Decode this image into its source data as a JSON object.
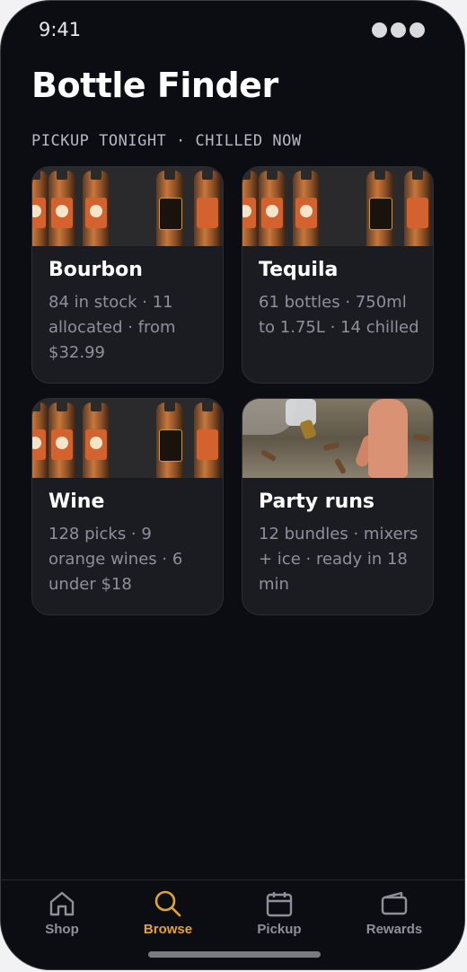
{
  "status": {
    "time": "9:41"
  },
  "header": {
    "title": "Bottle Finder",
    "subtitle": "PICKUP TONIGHT · CHILLED NOW"
  },
  "categories": [
    {
      "title": "Bourbon",
      "description": "84 in stock · 11 allocated · from $32.99",
      "image_icon": "bottles-photo"
    },
    {
      "title": "Tequila",
      "description": "61 bottles · 750ml to 1.75L · 14 chilled",
      "image_icon": "bottles-photo"
    },
    {
      "title": "Wine",
      "description": "128 picks · 9 orange wines · 6 under $18",
      "image_icon": "bottles-photo"
    },
    {
      "title": "Party runs",
      "description": "12 bundles · mixers + ice · ready in 18 min",
      "image_icon": "ground-photo"
    }
  ],
  "tabbar": {
    "items": [
      {
        "label": "Shop",
        "icon": "home-icon"
      },
      {
        "label": "Browse",
        "icon": "search-icon",
        "active": true
      },
      {
        "label": "Pickup",
        "icon": "calendar-icon"
      },
      {
        "label": "Rewards",
        "icon": "wallet-icon"
      }
    ],
    "accent_color": "#e3a52a"
  }
}
